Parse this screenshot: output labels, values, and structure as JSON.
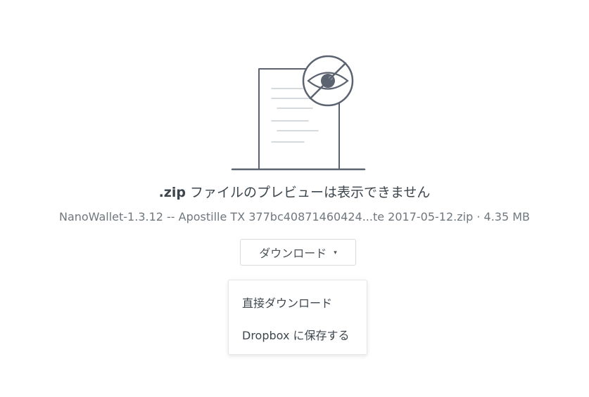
{
  "preview": {
    "extension": ".zip",
    "message": " ファイルのプレビューは表示できません",
    "file_name": "NanoWallet-1.3.12 -- Apostille TX 377bc40871460424...te 2017-05-12.zip",
    "separator": " · ",
    "file_size": "4.35 MB",
    "illustration_icon": "document-with-hidden-eye-icon"
  },
  "download": {
    "label": "ダウンロード",
    "caret": "▾",
    "menu": {
      "direct_download": "直接ダウンロード",
      "save_to_dropbox": "Dropbox に保存する"
    }
  },
  "colors": {
    "text_primary": "#3d464d",
    "text_secondary": "#70777d",
    "border": "#d8dbde",
    "illustration_stroke": "#5c6370"
  }
}
